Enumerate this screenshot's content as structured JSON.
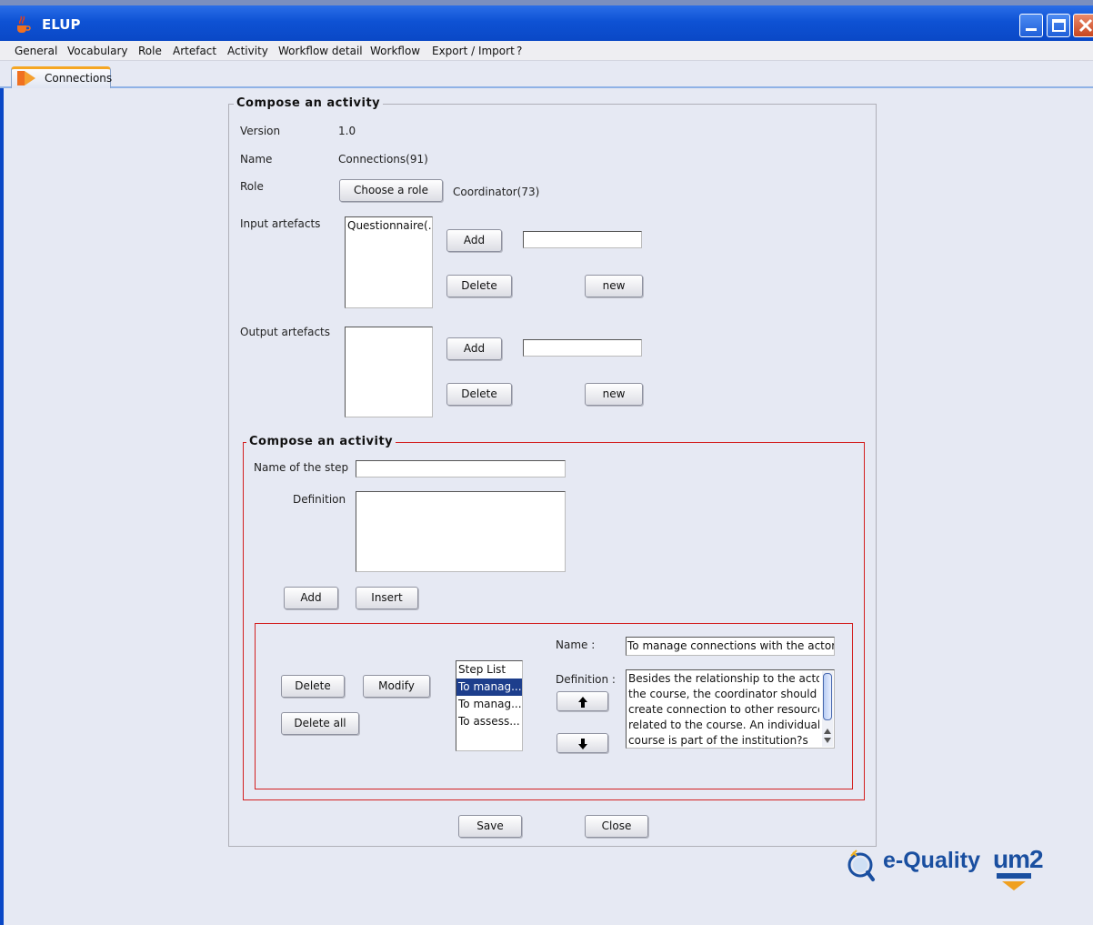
{
  "window": {
    "title": "ELUP",
    "icon": "java-cup-icon",
    "controls": [
      "minimize-icon",
      "maximize-icon",
      "close-icon"
    ]
  },
  "menu": [
    "General",
    "Vocabulary",
    "Role",
    "Artefact",
    "Activity",
    "Workflow detail",
    "Workflow",
    "Export / Import",
    "?"
  ],
  "tab": {
    "label": "Connections",
    "icon": "connections-tab-icon"
  },
  "compose": {
    "legend": "Compose an activity",
    "version_label": "Version",
    "version_value": "1.0",
    "name_label": "Name",
    "name_value": "Connections(91)",
    "role_label": "Role",
    "choose_role_button": "Choose a role",
    "role_value": "Coordinator(73)",
    "input_artefacts_label": "Input artefacts",
    "input_artefacts_items": [
      "Questionnaire(..."
    ],
    "output_artefacts_label": "Output artefacts",
    "output_artefacts_items": [],
    "add_button": "Add",
    "delete_button": "Delete",
    "new_button": "new"
  },
  "step": {
    "legend": "Compose an activity",
    "name_label": "Name of the step",
    "name_value": "",
    "definition_label": "Definition",
    "definition_value": "",
    "add_button": "Add",
    "insert_button": "Insert"
  },
  "steplist": {
    "delete_button": "Delete",
    "modify_button": "Modify",
    "delete_all_button": "Delete all",
    "items": [
      "Step List",
      "To manag...",
      "To manag...",
      "To assess..."
    ],
    "selected_index": 1,
    "name_label": "Name :",
    "name_value": "To manage connections with the actors in",
    "definition_label": "Definition :",
    "definition_lines": [
      "Besides the relationship to the actors in",
      "the course, the coordinator should",
      "create connection to other resources",
      "related to the course. An individual",
      "course is part of the institution?s"
    ]
  },
  "footer": {
    "save_button": "Save",
    "close_button": "Close"
  },
  "logos": {
    "equality": "e-Quality",
    "um2": "um2"
  },
  "colors": {
    "titlebar": "#0e52d4",
    "accent_red": "#d32020",
    "selection": "#1d3e8c",
    "equality_blue": "#1a4fa0"
  }
}
